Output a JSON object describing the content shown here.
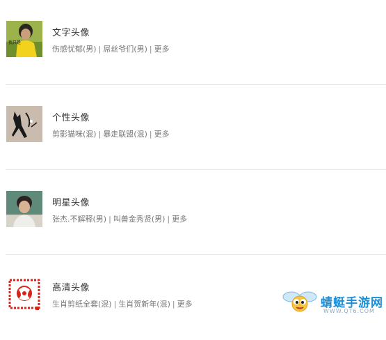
{
  "categories": [
    {
      "title": "文字头像",
      "links": [
        "伤感忧郁(男)",
        "屌丝爷们(男)",
        "更多"
      ],
      "thumb_icon": "boy-yellow-shirt-image"
    },
    {
      "title": "个性头像",
      "links": [
        "剪影猫咪(混)",
        "暴走联盟(混)",
        "更多"
      ],
      "thumb_icon": "cat-silhouette-image"
    },
    {
      "title": "明星头像",
      "links": [
        "张杰.不解释(男)",
        "叫兽金秀贤(男)",
        "更多"
      ],
      "thumb_icon": "star-portrait-image"
    },
    {
      "title": "高清头像",
      "links": [
        "生肖剪纸全套(混)",
        "生肖贺新年(混)",
        "更多"
      ],
      "thumb_icon": "papercut-zodiac-image"
    }
  ],
  "watermark": {
    "name": "蜻蜓手游网",
    "url": "WWW.QT6.COM",
    "icon": "dragonfly-mascot-icon"
  },
  "colors": {
    "title": "#333333",
    "link": "#777777",
    "divider": "#e8e8e8",
    "brand": "#1c8fd8"
  }
}
